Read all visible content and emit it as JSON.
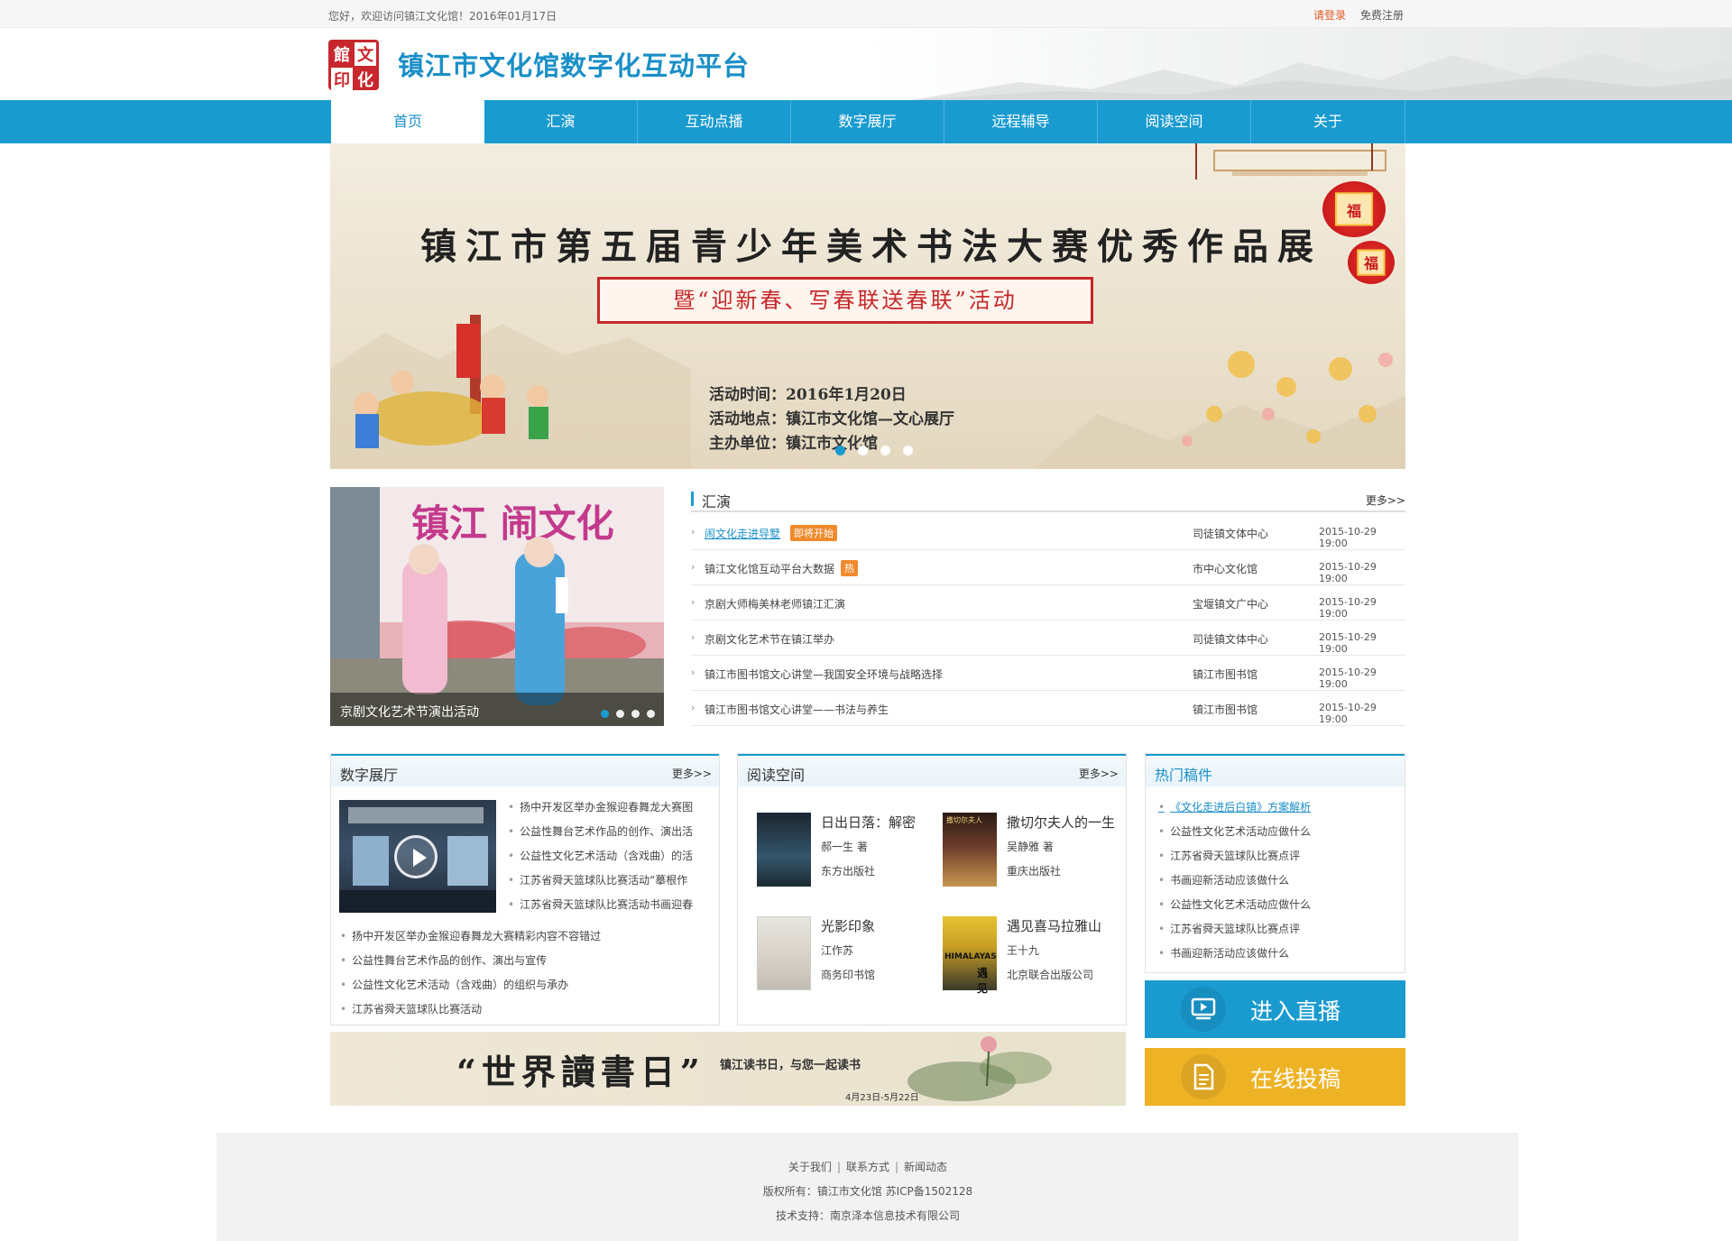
{
  "topbar": {
    "welcome": "您好，欢迎访问镇江文化馆！2016年01月17日",
    "login": "请登录",
    "register": "免费注册"
  },
  "header": {
    "logo_chars": [
      "館",
      "文",
      "印",
      "化"
    ],
    "title": "镇江市文化馆数字化互动平台"
  },
  "nav": {
    "items": [
      "首页",
      "汇演",
      "互动点播",
      "数字展厅",
      "远程辅导",
      "阅读空间",
      "关于"
    ],
    "active_index": 0
  },
  "banner": {
    "headline": "镇江市第五届青少年美术书法大赛优秀作品展",
    "subline": "暨“迎新春、写春联送春联”活动",
    "time": "活动时间：2016年1月20日",
    "place": "活动地点：镇江市文化馆—文心展厅",
    "host": "主办单位：镇江市文化馆",
    "lantern_char": "福",
    "slide_count": 4,
    "active_slide": 0
  },
  "photo_slider": {
    "caption": "京剧文化艺术节演出活动",
    "sign_text": "镇江 闹文化",
    "slide_count": 4,
    "active_slide": 0
  },
  "huiyan": {
    "title": "汇演",
    "more": "更多>>",
    "rows": [
      {
        "name": "闹文化走进导墅",
        "tag": "即将开始",
        "org": "司徒镇文体中心",
        "date": "2015-10-29 19:00",
        "link": true
      },
      {
        "name": "镇江文化馆互动平台大数据",
        "tag": "热",
        "org": "市中心文化馆",
        "date": "2015-10-29 19:00",
        "link": false
      },
      {
        "name": "京剧大师梅美林老师镇江汇演",
        "tag": "",
        "org": "宝堰镇文广中心",
        "date": "2015-10-29 19:00",
        "link": false
      },
      {
        "name": "京剧文化艺术节在镇江举办",
        "tag": "",
        "org": "司徒镇文体中心",
        "date": "2015-10-29 19:00",
        "link": false
      },
      {
        "name": "镇江市图书馆文心讲堂—我国安全环境与战略选择",
        "tag": "",
        "org": "镇江市图书馆",
        "date": "2015-10-29 19:00",
        "link": false
      },
      {
        "name": "镇江市图书馆文心讲堂——书法与养生",
        "tag": "",
        "org": "镇江市图书馆",
        "date": "2015-10-29 19:00",
        "link": false
      }
    ]
  },
  "digital": {
    "title": "数字展厅",
    "more": "更多>>",
    "side_items": [
      "扬中开发区举办金猴迎春舞龙大赛图",
      "公益性舞台艺术作品的创作、演出活",
      "公益性文化艺术活动（含戏曲）的活",
      "江苏省舜天篮球队比赛活动“摹根作",
      "江苏省舜天篮球队比赛活动书画迎春"
    ],
    "items": [
      "扬中开发区举办金猴迎春舞龙大赛精彩内容不容错过",
      "公益性舞台艺术作品的创作、演出与宣传",
      "公益性文化艺术活动（含戏曲）的组织与承办",
      "江苏省舜天篮球队比赛活动"
    ]
  },
  "reading": {
    "title": "阅读空间",
    "more": "更多>>",
    "books": [
      {
        "title": "日出日落：解密",
        "author": "郝一生 著",
        "publisher": "东方出版社"
      },
      {
        "title": "撒切尔夫人的一生",
        "author": "吴静雅 著",
        "publisher": "重庆出版社"
      },
      {
        "title": "光影印象",
        "author": "江作苏",
        "publisher": "商务印书馆"
      },
      {
        "title": "遇见喜马拉雅山",
        "author": "王十九",
        "publisher": "北京联合出版公司"
      }
    ],
    "cover_texts": [
      "撒切尔夫人",
      "HIMALAYAS",
      "遇见"
    ]
  },
  "hot": {
    "title": "热门稿件",
    "items": [
      {
        "text": "《文化走进后白镇》方案解析",
        "link": true
      },
      {
        "text": "公益性文化艺术活动应做什么",
        "link": false
      },
      {
        "text": "江苏省舜天篮球队比赛点评",
        "link": false
      },
      {
        "text": "书画迎新活动应该做什么",
        "link": false
      },
      {
        "text": "公益性文化艺术活动应做什么",
        "link": false
      },
      {
        "text": "江苏省舜天篮球队比赛点评",
        "link": false
      },
      {
        "text": "书画迎新活动应该做什么",
        "link": false
      }
    ]
  },
  "buttons": {
    "live": "进入直播",
    "submit": "在线投稿"
  },
  "reading_day": {
    "title": "“世界讀書日”",
    "sub": "镇江读书日，与您一起读书",
    "dates": "4月23日-5月22日"
  },
  "footer": {
    "links": [
      "关于我们",
      "联系方式",
      "新闻动态"
    ],
    "copyright": "版权所有：镇江市文化馆 苏ICP备1502128",
    "tech": "技术支持：南京泽本信息技术有限公司"
  },
  "colors": {
    "brand_blue": "#1a9bd0",
    "accent_red": "#c8272d",
    "tag_orange": "#f08a2c",
    "submit_yellow": "#eeb225"
  }
}
